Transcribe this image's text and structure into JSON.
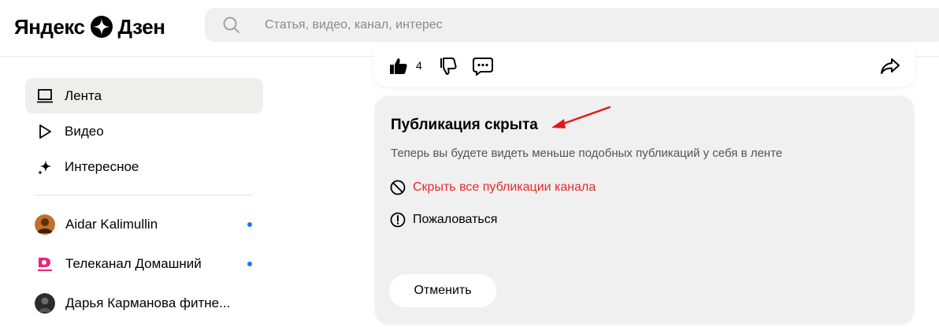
{
  "header": {
    "logo_left": "Яндекс",
    "logo_right": "Дзен",
    "search_placeholder": "Статья, видео, канал, интерес"
  },
  "sidebar": {
    "nav": [
      {
        "label": "Лента",
        "icon": "feed-icon",
        "active": true
      },
      {
        "label": "Видео",
        "icon": "play-icon",
        "active": false
      },
      {
        "label": "Интересное",
        "icon": "sparkle-icon",
        "active": false
      }
    ],
    "channels": [
      {
        "label": "Aidar Kalimullin",
        "has_update": true
      },
      {
        "label": "Телеканал Домашний",
        "has_update": true
      },
      {
        "label": "Дарья Карманова фитне...",
        "has_update": false
      }
    ]
  },
  "post_actions": {
    "like_count": "4",
    "icons": [
      "thumbs-up-icon",
      "thumbs-down-icon",
      "comment-icon",
      "share-icon"
    ]
  },
  "hidden_notice": {
    "title": "Публикация скрыта",
    "description": "Теперь вы будете видеть меньше подобных публикаций у себя в ленте",
    "block_label": "Скрыть все публикации канала",
    "report_label": "Пожаловаться",
    "cancel_label": "Отменить"
  },
  "colors": {
    "accent_red": "#e8282b",
    "notification_dot": "#1a73ff",
    "card_bg": "#f0f0f0",
    "annotation_arrow": "#e01b1b"
  }
}
